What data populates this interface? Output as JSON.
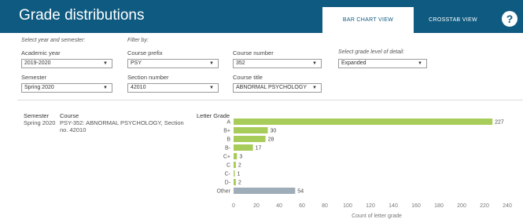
{
  "header": {
    "title": "Grade distributions",
    "tabs": [
      {
        "label": "BAR CHART VIEW",
        "active": true
      },
      {
        "label": "CROSSTAB VIEW",
        "active": false
      }
    ],
    "help_symbol": "?",
    "color": "#0f5a80"
  },
  "filters": {
    "select_year_semester_label": "Select year and semester:",
    "filter_by_label": "Filter by:",
    "academic_year": {
      "label": "Academic year",
      "value": "2019-2020"
    },
    "semester": {
      "label": "Semester",
      "value": "Spring 2020"
    },
    "course_prefix": {
      "label": "Course prefix",
      "value": "PSY"
    },
    "section_number": {
      "label": "Section number",
      "value": "42010"
    },
    "course_number": {
      "label": "Course number",
      "value": "352"
    },
    "course_title": {
      "label": "Course title",
      "value": "ABNORMAL PSYCHOLOGY"
    },
    "detail_level": {
      "label": "Select grade level of detail:",
      "value": "Expanded"
    }
  },
  "table": {
    "headers": {
      "semester": "Semester",
      "course": "Course",
      "letter_grade": "Letter Grade"
    },
    "row": {
      "semester": "Spring 2020",
      "course_line1": "PSY-352: ABNORMAL PSYCHOLOGY, Section",
      "course_line2": "no. 42010"
    }
  },
  "chart_data": {
    "type": "bar",
    "orientation": "horizontal",
    "categories": [
      "A",
      "B+",
      "B",
      "B-",
      "C+",
      "C",
      "C-",
      "D-",
      "Other"
    ],
    "values": [
      227,
      30,
      28,
      17,
      3,
      2,
      1,
      2,
      54
    ],
    "bar_colors": [
      "#a8cc5a",
      "#a8cc5a",
      "#a8cc5a",
      "#a8cc5a",
      "#a8cc5a",
      "#a8cc5a",
      "#a8cc5a",
      "#a8cc5a",
      "#9eadb8"
    ],
    "xlabel": "Count of letter grade",
    "xlim": [
      0,
      240
    ],
    "xticks": [
      0,
      20,
      40,
      60,
      80,
      100,
      120,
      140,
      160,
      180,
      200,
      220,
      240
    ],
    "grid": false
  }
}
